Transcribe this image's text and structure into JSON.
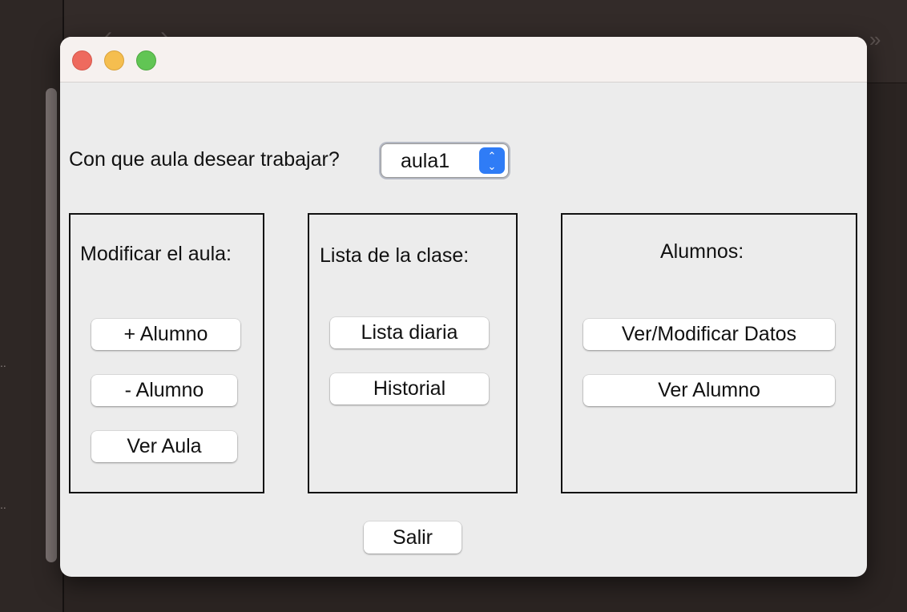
{
  "window": {
    "controls": {
      "close": "close-icon",
      "minimize": "minimize-icon",
      "zoom": "zoom-icon"
    }
  },
  "prompt": {
    "label": "Con que aula desear trabajar?",
    "select_value": "aula1"
  },
  "panels": {
    "modificar": {
      "title": "Modificar el aula:",
      "buttons": [
        "+ Alumno",
        "- Alumno",
        "Ver Aula"
      ]
    },
    "lista": {
      "title": "Lista de la clase:",
      "buttons": [
        "Lista diaria",
        "Historial"
      ]
    },
    "alumnos": {
      "title": "Alumnos:",
      "buttons": [
        "Ver/Modificar Datos",
        "Ver Alumno"
      ]
    }
  },
  "footer": {
    "exit_label": "Salir"
  },
  "colors": {
    "window_bg": "#ececec",
    "titlebar_bg": "#f6f1ef",
    "select_accent": "#2f7cf6",
    "close": "#ee6a5e",
    "minimize": "#f5be4f",
    "zoom": "#61c554"
  }
}
